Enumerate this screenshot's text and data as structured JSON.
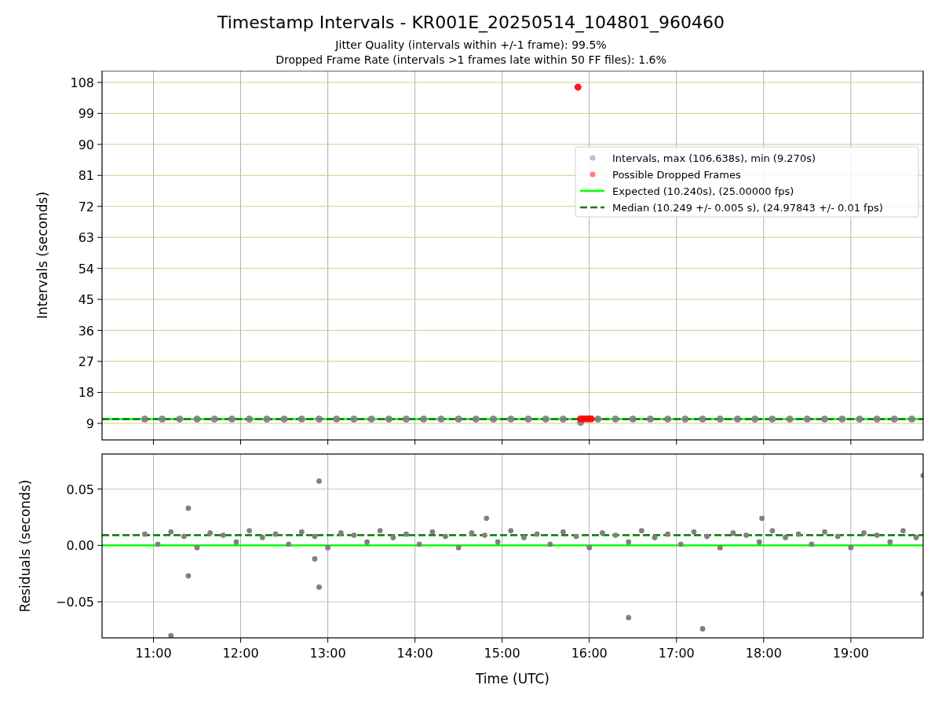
{
  "figure": {
    "title": "Timestamp Intervals - KR001E_20250514_104801_960460",
    "subtitles": [
      "Jitter Quality (intervals within +/-1 frame): 99.5%",
      "Dropped Frame Rate (intervals >1 frames late within 50 FF files): 1.6%"
    ]
  },
  "interval_chart": {
    "chart_data": {
      "type": "scatter",
      "grid": true,
      "legend": true,
      "ylabel": "Intervals (seconds)",
      "xlim": [
        10.41,
        19.83
      ],
      "ylim": [
        4.2,
        111.4
      ],
      "yticks": [
        {
          "value": 9,
          "label": "9"
        },
        {
          "value": 18,
          "label": "18"
        },
        {
          "value": 27,
          "label": "27"
        },
        {
          "value": 36,
          "label": "36"
        },
        {
          "value": 45,
          "label": "45"
        },
        {
          "value": 54,
          "label": "54"
        },
        {
          "value": 63,
          "label": "63"
        },
        {
          "value": 72,
          "label": "72"
        },
        {
          "value": 81,
          "label": "81"
        },
        {
          "value": 90,
          "label": "90"
        },
        {
          "value": 99,
          "label": "99"
        },
        {
          "value": 108,
          "label": "108"
        }
      ],
      "series": [
        {
          "name": "Intervals, max (106.638s), min (9.270s)",
          "type": "scatter",
          "color": "#808080",
          "x": [
            10.9,
            11.1,
            11.3,
            11.5,
            11.7,
            11.9,
            12.1,
            12.3,
            12.5,
            12.7,
            12.9,
            13.1,
            13.3,
            13.5,
            13.7,
            13.9,
            14.1,
            14.3,
            14.5,
            14.7,
            14.9,
            15.1,
            15.3,
            15.5,
            15.7,
            16.1,
            16.3,
            16.5,
            16.7,
            16.9,
            17.1,
            17.3,
            17.5,
            17.7,
            17.9,
            18.1,
            18.3,
            18.5,
            18.7,
            18.9,
            19.1,
            19.3,
            19.5,
            19.7,
            15.9
          ],
          "values": [
            10.25,
            10.25,
            10.25,
            10.25,
            10.25,
            10.25,
            10.25,
            10.25,
            10.25,
            10.25,
            10.25,
            10.25,
            10.25,
            10.25,
            10.25,
            10.25,
            10.25,
            10.25,
            10.25,
            10.25,
            10.25,
            10.25,
            10.25,
            10.25,
            10.25,
            10.25,
            10.25,
            10.25,
            10.25,
            10.25,
            10.25,
            10.25,
            10.25,
            10.25,
            10.25,
            10.25,
            10.25,
            10.25,
            10.25,
            10.25,
            10.25,
            10.25,
            10.25,
            10.25,
            9.27
          ]
        },
        {
          "name": "Possible Dropped Frames",
          "type": "scatter",
          "color": "#ff0000",
          "x": [
            15.9,
            15.94,
            15.98,
            16.02,
            15.87
          ],
          "values": [
            10.3,
            10.3,
            10.3,
            10.3,
            106.638
          ]
        },
        {
          "name": "Expected (10.240s), (25.00000 fps)",
          "type": "line",
          "color": "#00ff00",
          "x": [
            10.41,
            19.83
          ],
          "values": [
            10.24,
            10.24
          ]
        },
        {
          "name": "Median (10.249 +/- 0.005 s), (24.97843 +/- 0.01 fps)",
          "type": "line",
          "line_style": "dashed",
          "color": "#008000",
          "x": [
            10.41,
            19.83
          ],
          "values": [
            10.249,
            10.249
          ]
        }
      ]
    }
  },
  "residual_chart": {
    "chart_data": {
      "type": "scatter",
      "grid": true,
      "xlabel": "Time (UTC)",
      "ylabel": "Residuals (seconds)",
      "xlim": [
        10.41,
        19.83
      ],
      "ylim": [
        -0.082,
        0.081
      ],
      "xticks": [
        {
          "value": 11,
          "label": "11:00"
        },
        {
          "value": 12,
          "label": "12:00"
        },
        {
          "value": 13,
          "label": "13:00"
        },
        {
          "value": 14,
          "label": "14:00"
        },
        {
          "value": 15,
          "label": "15:00"
        },
        {
          "value": 16,
          "label": "16:00"
        },
        {
          "value": 17,
          "label": "17:00"
        },
        {
          "value": 18,
          "label": "18:00"
        },
        {
          "value": 19,
          "label": "19:00"
        }
      ],
      "yticks": [
        {
          "value": -0.05,
          "label": "−0.05"
        },
        {
          "value": 0,
          "label": "0.00"
        },
        {
          "value": 0.05,
          "label": "0.05"
        }
      ],
      "series": [
        {
          "type": "scatter",
          "color": "#808080",
          "x": [
            10.9,
            11.05,
            11.2,
            11.35,
            11.5,
            11.65,
            11.8,
            11.95,
            12.1,
            12.25,
            12.4,
            12.55,
            12.7,
            12.85,
            13.0,
            13.15,
            13.3,
            13.45,
            13.6,
            13.75,
            13.9,
            14.05,
            14.2,
            14.35,
            14.5,
            14.65,
            14.8,
            14.95,
            15.1,
            15.25,
            15.4,
            15.55,
            15.7,
            15.85,
            16.0,
            16.15,
            16.3,
            16.45,
            16.6,
            16.75,
            16.9,
            17.05,
            17.2,
            17.35,
            17.5,
            17.65,
            17.8,
            17.95,
            18.1,
            18.25,
            18.4,
            18.55,
            18.7,
            18.85,
            19.0,
            19.15,
            19.3,
            19.45,
            19.6,
            19.75,
            11.2,
            11.4,
            11.4,
            12.9,
            12.9,
            12.85,
            16.45,
            17.3,
            19.83,
            19.83,
            14.82,
            17.98
          ],
          "values": [
            0.01,
            0.001,
            0.012,
            0.008,
            -0.002,
            0.011,
            0.009,
            0.003,
            0.013,
            0.007,
            0.01,
            0.001,
            0.012,
            0.008,
            -0.002,
            0.011,
            0.009,
            0.003,
            0.013,
            0.007,
            0.01,
            0.001,
            0.012,
            0.008,
            -0.002,
            0.011,
            0.009,
            0.003,
            0.013,
            0.007,
            0.01,
            0.001,
            0.012,
            0.008,
            -0.002,
            0.011,
            0.009,
            0.003,
            0.013,
            0.007,
            0.01,
            0.001,
            0.012,
            0.008,
            -0.002,
            0.011,
            0.009,
            0.003,
            0.013,
            0.007,
            0.01,
            0.001,
            0.012,
            0.008,
            -0.002,
            0.011,
            0.009,
            0.003,
            0.013,
            0.007,
            -0.08,
            0.033,
            -0.027,
            0.057,
            -0.037,
            -0.012,
            -0.064,
            -0.074,
            0.062,
            -0.043,
            0.024,
            0.024
          ]
        },
        {
          "type": "line",
          "color": "#00ff00",
          "x": [
            10.41,
            19.83
          ],
          "values": [
            0,
            0
          ]
        },
        {
          "type": "line",
          "line_style": "dashed",
          "color": "#008000",
          "x": [
            10.41,
            19.83
          ],
          "values": [
            0.009,
            0.009
          ]
        }
      ]
    }
  }
}
